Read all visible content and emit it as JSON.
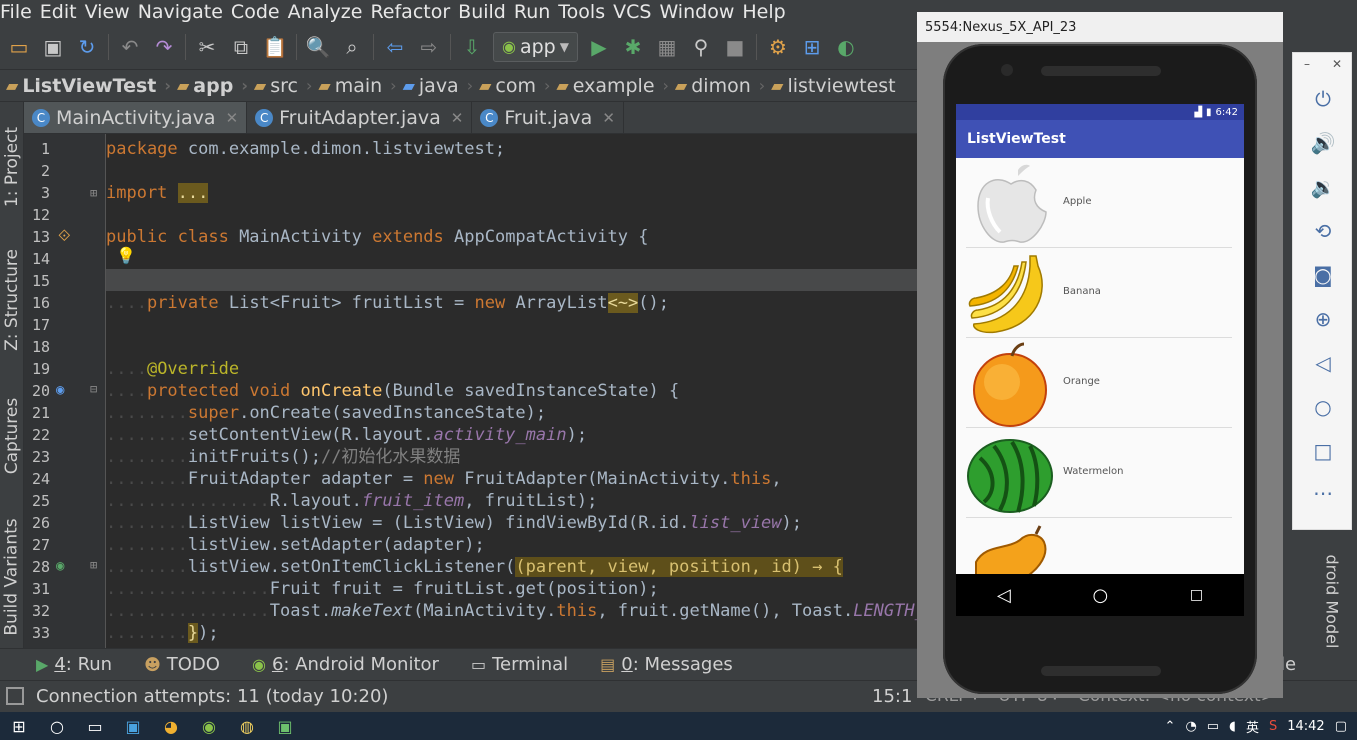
{
  "menu": [
    "File",
    "Edit",
    "View",
    "Navigate",
    "Code",
    "Analyze",
    "Refactor",
    "Build",
    "Run",
    "Tools",
    "VCS",
    "Window",
    "Help"
  ],
  "toolbar": {
    "run_config": "app"
  },
  "breadcrumb": [
    "ListViewTest",
    "app",
    "src",
    "main",
    "java",
    "com",
    "example",
    "dimon",
    "listviewtest"
  ],
  "left_tools": {
    "project": "1: Project",
    "structure": "Z: Structure",
    "captures": "Captures",
    "build_variants": "Build Variants"
  },
  "editor_tabs": [
    {
      "label": "MainActivity.java",
      "active": true
    },
    {
      "label": "FruitAdapter.java",
      "active": false
    },
    {
      "label": "Fruit.java",
      "active": false
    }
  ],
  "code": {
    "line_numbers": [
      "1",
      "2",
      "3",
      "12",
      "13",
      "14",
      "15",
      "16",
      "17",
      "18",
      "19",
      "20",
      "21",
      "22",
      "23",
      "24",
      "25",
      "26",
      "27",
      "28",
      "31",
      "32",
      "33"
    ],
    "fold_import": "...",
    "comment": "//初始化水果数据",
    "lambda_params": "(parent, view, position, id) → {",
    "diamond": "<~>"
  },
  "bottom_tabs": [
    {
      "key": "4",
      "label": "Run"
    },
    {
      "key": "",
      "label": "TODO"
    },
    {
      "key": "6",
      "label": "Android Monitor"
    },
    {
      "key": "",
      "label": "Terminal"
    },
    {
      "key": "0",
      "label": "Messages"
    }
  ],
  "status": {
    "message": "Connection attempts: 11 (today 10:20)",
    "position": "15:1",
    "line_sep": "CRLF÷",
    "encoding": "UTF-8÷",
    "context": "Context: <no context>"
  },
  "right_partial": {
    "bottom_tab": "ole",
    "strip": "droid Model"
  },
  "emulator": {
    "title": "5554:Nexus_5X_API_23",
    "clock": "6:42",
    "app_title": "ListViewTest",
    "fruits": [
      "Apple",
      "Banana",
      "Orange",
      "Watermelon"
    ]
  },
  "taskbar": {
    "ime": "英",
    "time": "14:42"
  },
  "colors": {
    "appbar": "#3f51b5",
    "statusbar": "#303f9f",
    "keyword": "#cc7832",
    "string": "#6a8759",
    "function": "#ffc66d",
    "field": "#9876aa"
  }
}
